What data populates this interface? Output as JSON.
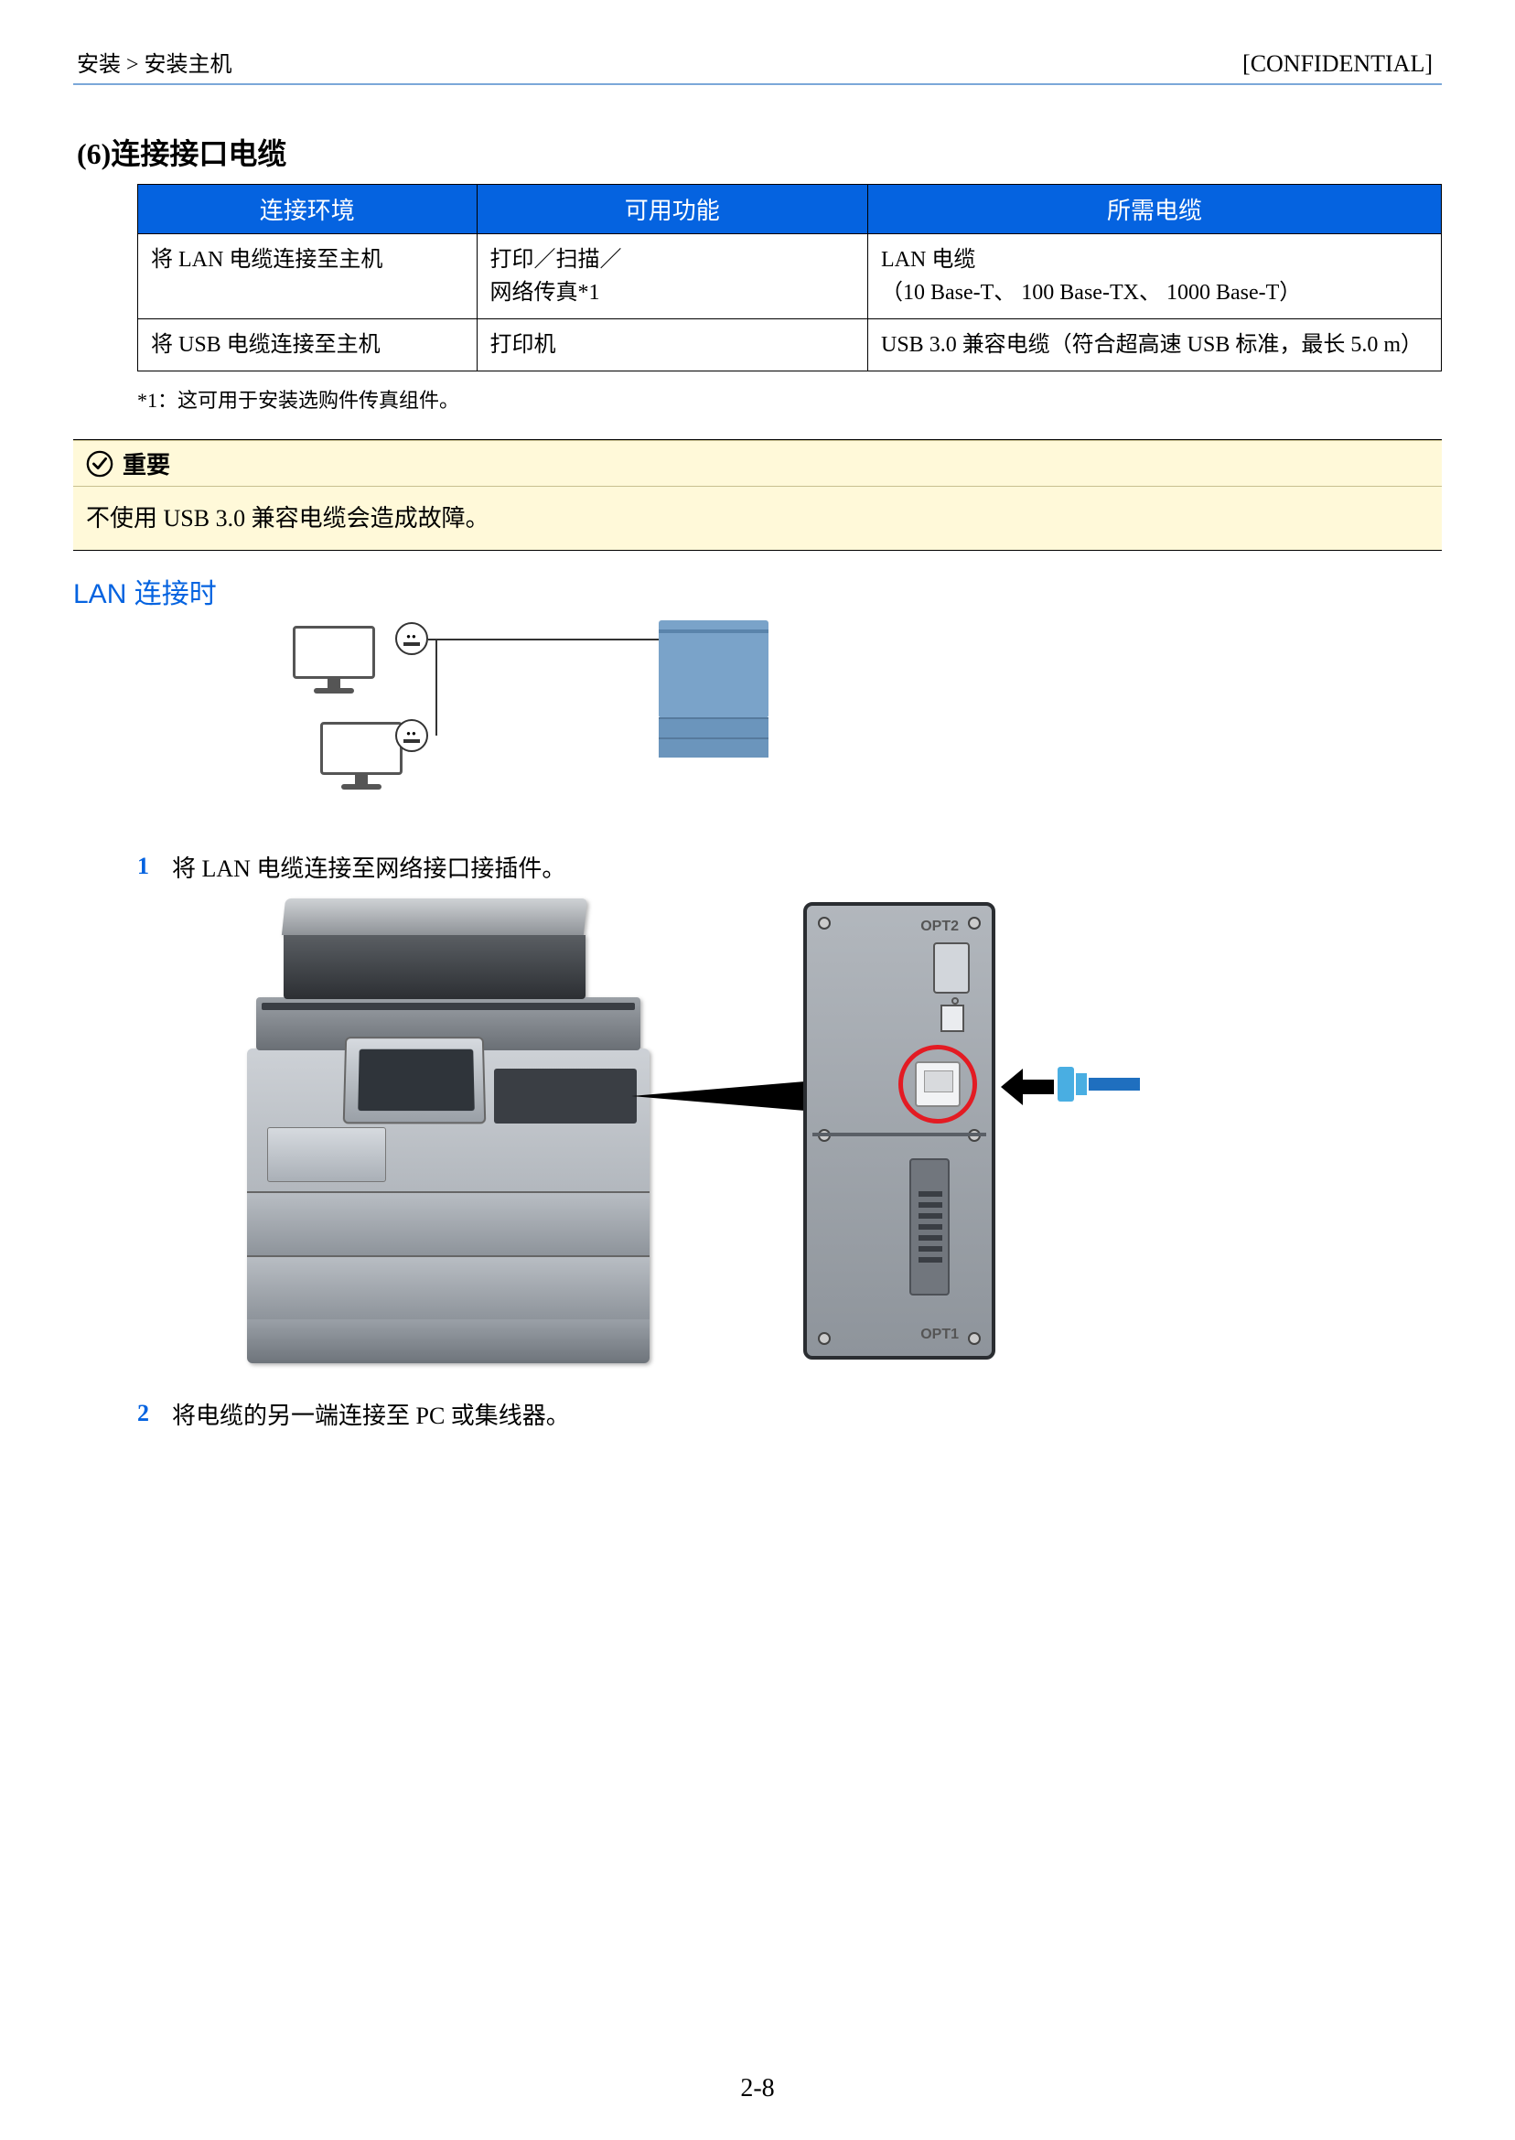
{
  "header": {
    "breadcrumb": "安装 > 安装主机",
    "confidential": "[CONFIDENTIAL]"
  },
  "section_title": "(6)连接接口电缆",
  "table": {
    "headers": [
      "连接环境",
      "可用功能",
      "所需电缆"
    ],
    "rows": [
      {
        "env": "将 LAN 电缆连接至主机",
        "func": "打印／扫描／\n网络传真*1",
        "cable": "LAN 电缆\n（10 Base-T、 100 Base-TX、 1000 Base-T）"
      },
      {
        "env": "将 USB 电缆连接至主机",
        "func": "打印机",
        "cable": "USB 3.0 兼容电缆（符合超高速 USB 标准，最长 5.0 m）"
      }
    ]
  },
  "footnote": "*1：这可用于安装选购件传真组件。",
  "important": {
    "label": "重要",
    "body": "不使用 USB 3.0 兼容电缆会造成故障。"
  },
  "sub_heading": "LAN 连接时",
  "diagram1_labels": {
    "opt1": "OPT1",
    "opt2": "OPT2"
  },
  "steps": [
    {
      "num": "1",
      "text": "将 LAN 电缆连接至网络接口接插件。"
    },
    {
      "num": "2",
      "text": "将电缆的另一端连接至 PC 或集线器。"
    }
  ],
  "page_number": "2-8"
}
